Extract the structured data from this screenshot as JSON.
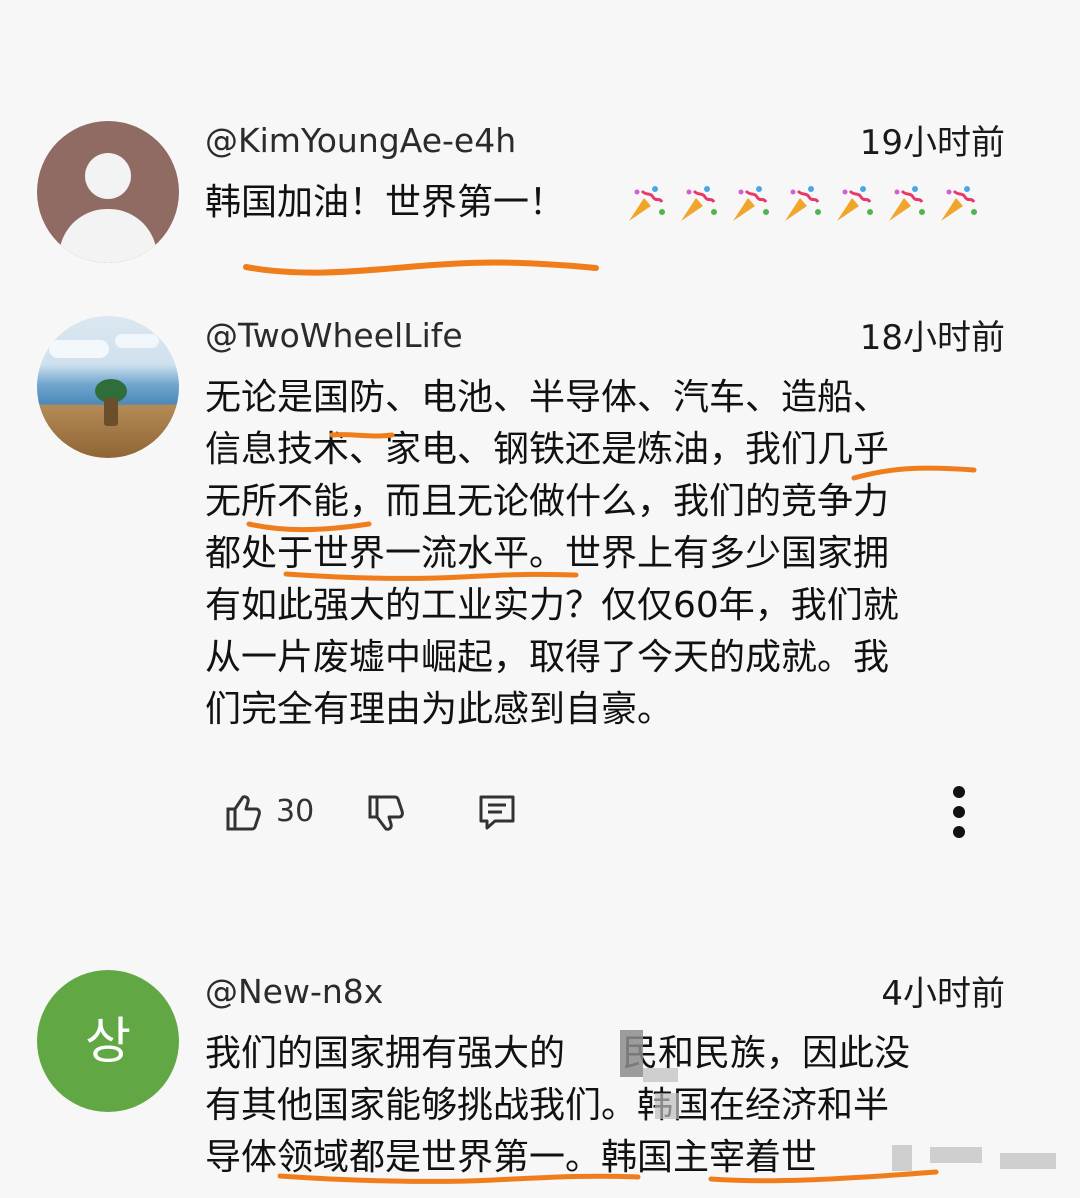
{
  "comments": [
    {
      "username": "@KimYoungAe-e4h",
      "timestamp": "19小时前",
      "lines": [
        "韩国加油！世界第一！"
      ],
      "reactions": [
        "party-popper",
        "party-popper",
        "party-popper",
        "party-popper",
        "party-popper",
        "party-popper",
        "party-popper"
      ]
    },
    {
      "username": "@TwoWheelLife",
      "timestamp": "18小时前",
      "lines": [
        "无论是国防、电池、半导体、汽车、造船、",
        "信息技术、家电、钢铁还是炼油，我们几乎",
        "无所不能，而且无论做什么，我们的竞争力",
        "都处于世界一流水平。世界上有多少国家拥",
        "有如此强大的工业实力？仅仅60年，我们就",
        "从一片废墟中崛起，取得了今天的成就。我",
        "们完全有理由为此感到自豪。"
      ],
      "likes": "30",
      "actions": {
        "like_icon": "thumbs-up-icon",
        "dislike_icon": "thumbs-down-icon",
        "reply_icon": "comment-reply-icon",
        "more_icon": "more-vertical-icon"
      }
    },
    {
      "username": "@New-n8x",
      "timestamp": "4小时前",
      "avatar_letter": "상",
      "lines": [
        "我们的国家拥有强大的",
        "民和民族，因此没",
        "有其他国家能够挑战我们。韩国在经济和半",
        "导体领域都是世界第一。韩国主宰着世"
      ]
    }
  ],
  "colors": {
    "background": "#f7f7f7",
    "underline": "#f07d1b",
    "avatar_default": "#8f6b63",
    "avatar_letter_bg": "#61a845"
  }
}
